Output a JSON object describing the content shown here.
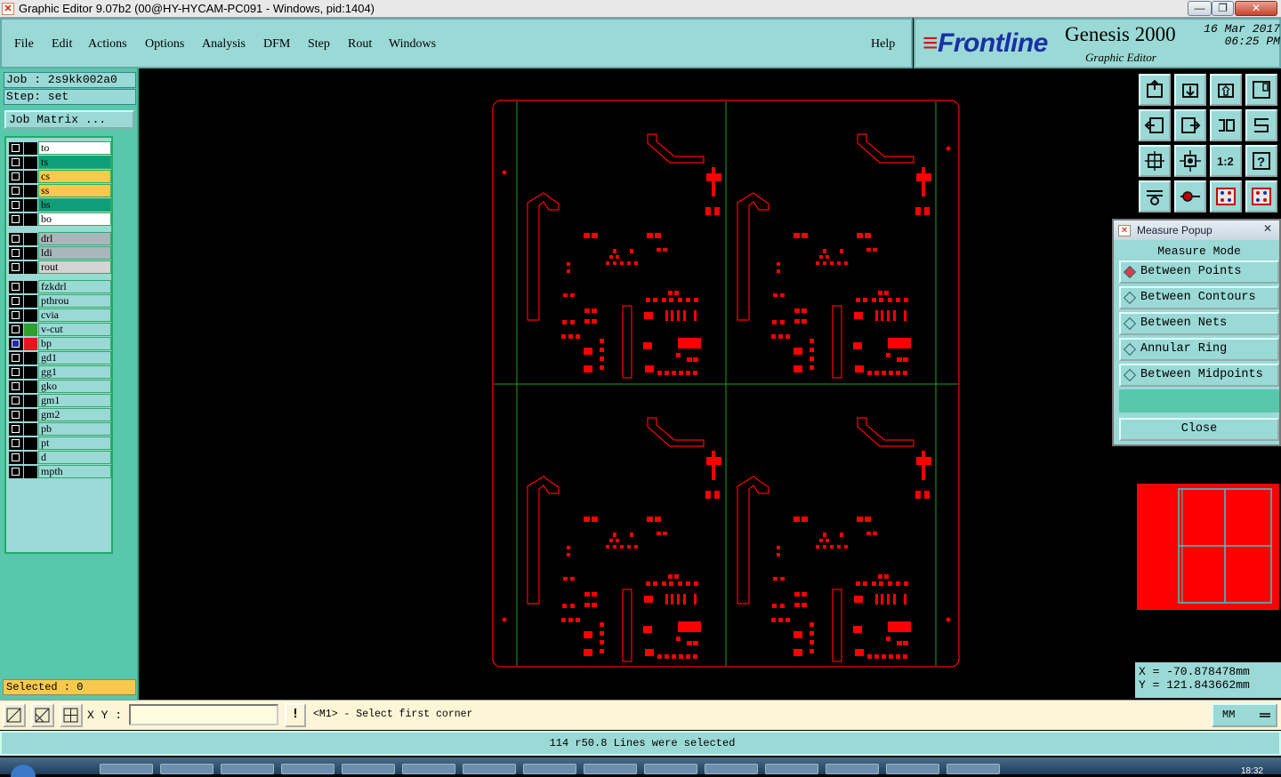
{
  "window": {
    "title": "Graphic Editor 9.07b2 (00@HY-HYCAM-PC091 - Windows, pid:1404)",
    "minimize": "—",
    "maximize": "❐",
    "close": "✕"
  },
  "menu": {
    "items": [
      "File",
      "Edit",
      "Actions",
      "Options",
      "Analysis",
      "DFM",
      "Step",
      "Rout",
      "Windows"
    ],
    "help": "Help"
  },
  "brand": {
    "logo": "Frontline",
    "product": "Genesis 2000",
    "subtitle": "Graphic Editor",
    "date": "16 Mar 2017",
    "time": "06:25 PM"
  },
  "job": {
    "job_label": "Job : 2s9kk002a0",
    "step_label": "Step: set",
    "matrix_button": "Job Matrix ..."
  },
  "layers": [
    {
      "name": "to",
      "color": "#ffffff"
    },
    {
      "name": "ts",
      "color": "#0f9e7a"
    },
    {
      "name": "cs",
      "color": "#f8c94c"
    },
    {
      "name": "ss",
      "color": "#f8c94c"
    },
    {
      "name": "bs",
      "color": "#0f9e7a"
    },
    {
      "name": "bo",
      "color": "#ffffff"
    },
    {
      "name": "drl",
      "color": "#a9b7bc"
    },
    {
      "name": "ldi",
      "color": "#a9b7bc"
    },
    {
      "name": "rout",
      "color": "#d4d4d4"
    },
    {
      "name": "fzkdrl",
      "color": "#9ad9d6"
    },
    {
      "name": "pthrou",
      "color": "#9ad9d6"
    },
    {
      "name": "cvia",
      "color": "#9ad9d6"
    },
    {
      "name": "v-cut",
      "color": "#9ad9d6",
      "swatch": "#2e9e2e"
    },
    {
      "name": "bp",
      "color": "#9ad9d6",
      "swatch": "#e8161c",
      "active": true
    },
    {
      "name": "gd1",
      "color": "#9ad9d6"
    },
    {
      "name": "gg1",
      "color": "#9ad9d6"
    },
    {
      "name": "gko",
      "color": "#9ad9d6"
    },
    {
      "name": "gm1",
      "color": "#9ad9d6"
    },
    {
      "name": "gm2",
      "color": "#9ad9d6"
    },
    {
      "name": "pb",
      "color": "#9ad9d6"
    },
    {
      "name": "pt",
      "color": "#9ad9d6"
    },
    {
      "name": "d",
      "color": "#9ad9d6"
    },
    {
      "name": "mpth",
      "color": "#9ad9d6"
    }
  ],
  "selected_label": "Selected : 0",
  "measure": {
    "title": "Measure Popup",
    "close_x": "✕",
    "header": "Measure Mode",
    "options": [
      "Between Points",
      "Between Contours",
      "Between Nets",
      "Annular Ring",
      "Between Midpoints"
    ],
    "selected_option": "Between Points",
    "close_button": "Close"
  },
  "coords": {
    "x": "X = -70.878478mm",
    "y": "Y = 121.843662mm"
  },
  "command": {
    "xy_label": "X Y :",
    "xy_value": "",
    "warn": "!",
    "prompt": "<M1> - Select first corner",
    "units": "MM"
  },
  "status": "114 r50.8 Lines were selected",
  "taskbar": {
    "clock": "18:32"
  },
  "colors": {
    "accent": "#9ad9d6",
    "panel": "#59c7ac",
    "pad": "#ff0000",
    "vcut": "#1fa01f"
  }
}
